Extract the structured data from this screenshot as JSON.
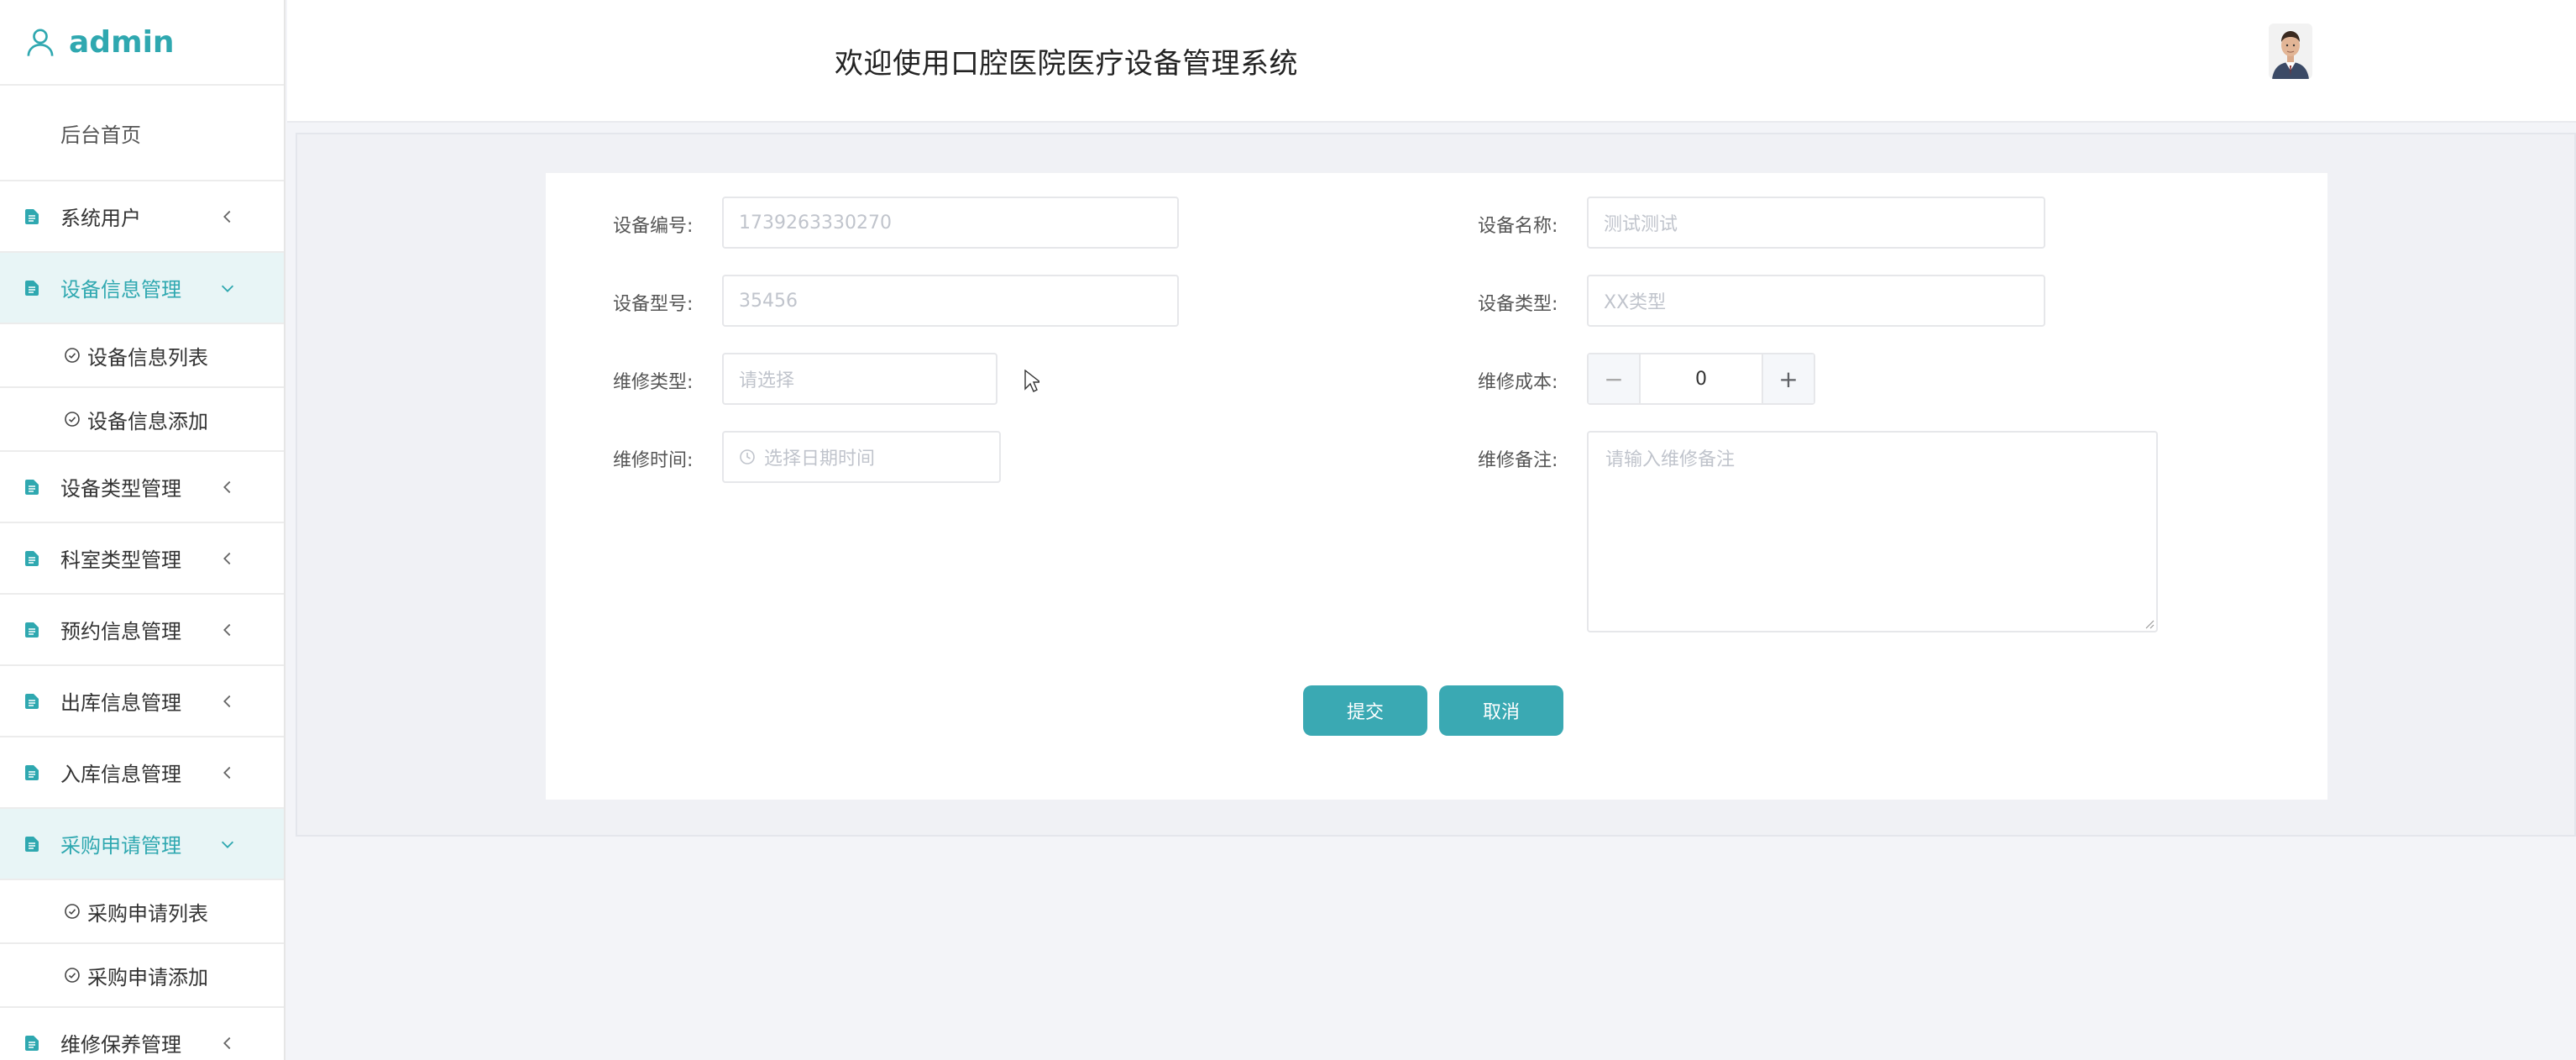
{
  "sidebar": {
    "brand": "admin",
    "home": "后台首页",
    "items": [
      {
        "label": "系统用户",
        "open": false
      },
      {
        "label": "设备信息管理",
        "open": true,
        "children": [
          "设备信息列表",
          "设备信息添加"
        ]
      },
      {
        "label": "设备类型管理",
        "open": false
      },
      {
        "label": "科室类型管理",
        "open": false
      },
      {
        "label": "预约信息管理",
        "open": false
      },
      {
        "label": "出库信息管理",
        "open": false
      },
      {
        "label": "入库信息管理",
        "open": false
      },
      {
        "label": "采购申请管理",
        "open": true,
        "children": [
          "采购申请列表",
          "采购申请添加"
        ]
      },
      {
        "label": "维修保养管理",
        "open": false
      }
    ]
  },
  "header": {
    "title": "欢迎使用口腔医院医疗设备管理系统"
  },
  "form": {
    "device_no": {
      "label": "设备编号:",
      "value": "1739263330270"
    },
    "device_name": {
      "label": "设备名称:",
      "value": "测试测试"
    },
    "device_model": {
      "label": "设备型号:",
      "value": "35456"
    },
    "device_type": {
      "label": "设备类型:",
      "value": "XX类型"
    },
    "repair_type": {
      "label": "维修类型:",
      "placeholder": "请选择"
    },
    "repair_cost": {
      "label": "维修成本:",
      "value": "0",
      "minus": "−",
      "plus": "+"
    },
    "repair_time": {
      "label": "维修时间:",
      "placeholder": "选择日期时间"
    },
    "repair_note": {
      "label": "维修备注:",
      "placeholder": "请输入维修备注"
    },
    "submit_label": "提交",
    "cancel_label": "取消"
  },
  "colors": {
    "accent": "#3aa9b3",
    "brand": "#2fa8b0",
    "menu_open_bg": "#e8f5f6"
  },
  "icons": {
    "brand": "user-icon",
    "menu": "document-icon",
    "submenu": "check-circle-icon",
    "collapsed": "chevron-left-icon",
    "expanded": "chevron-down-icon",
    "date": "clock-icon"
  }
}
